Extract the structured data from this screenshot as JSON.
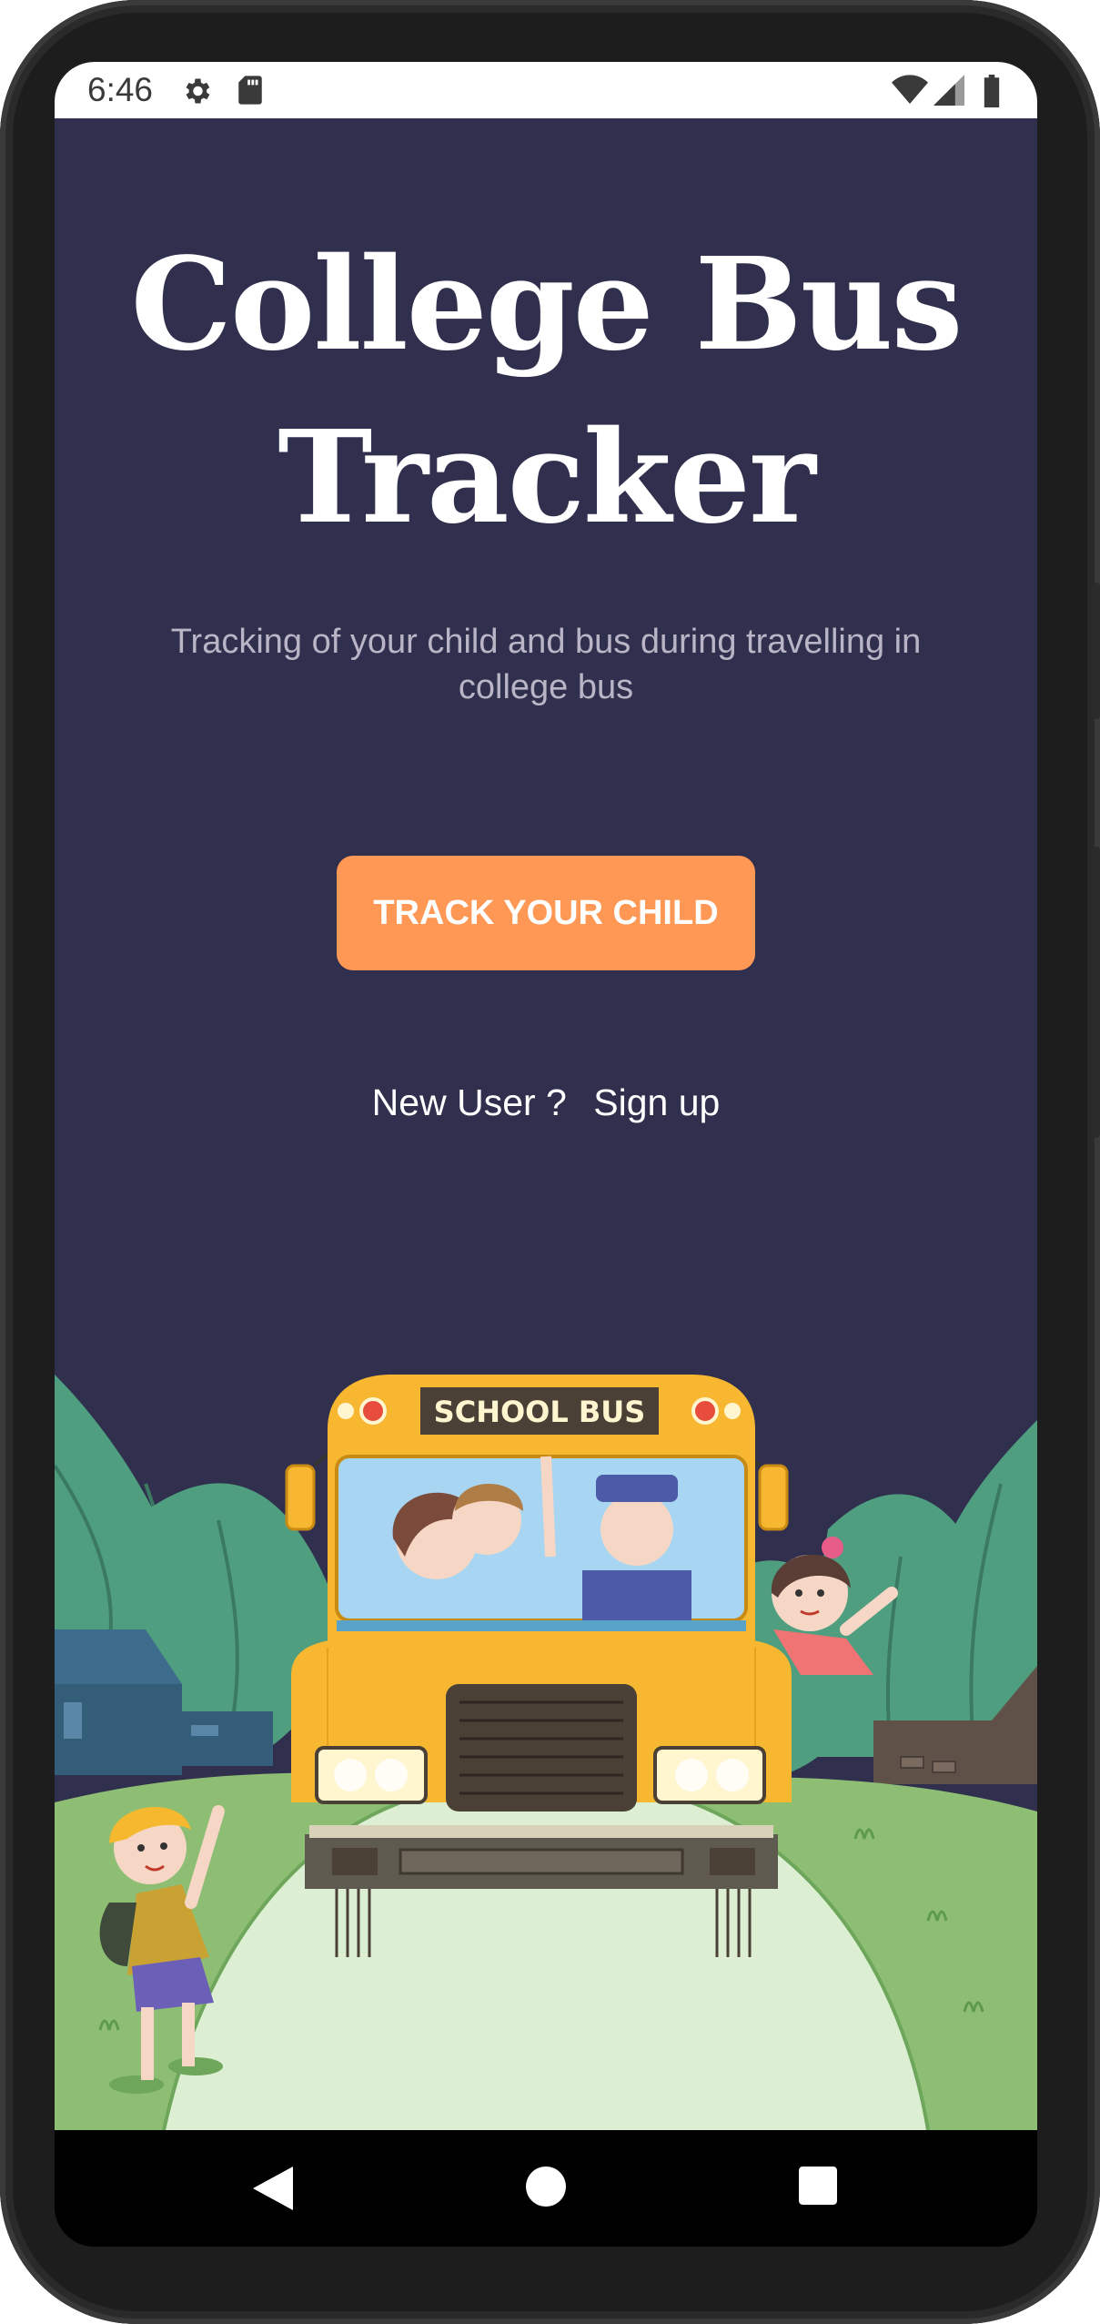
{
  "status_bar": {
    "time": "6:46",
    "icons": [
      "gear-icon",
      "sd-card-icon",
      "wifi-icon",
      "signal-icon",
      "battery-icon"
    ]
  },
  "app": {
    "title_line1": "College Bus",
    "title_line2": "Tracker",
    "subtitle": "Tracking of your child and bus during travelling in college bus",
    "track_button_label": "TRACK YOUR CHILD",
    "new_user_text": "New User ?",
    "signup_link_label": "Sign up",
    "bus_sign_text": "SCHOOL BUS"
  },
  "nav_bar": {
    "buttons": [
      "back-icon",
      "home-icon",
      "recents-icon"
    ]
  },
  "colors": {
    "background": "#302f4e",
    "accent": "#ff9855",
    "subtitle": "#b9b5c6",
    "bus_yellow": "#f7b731"
  }
}
